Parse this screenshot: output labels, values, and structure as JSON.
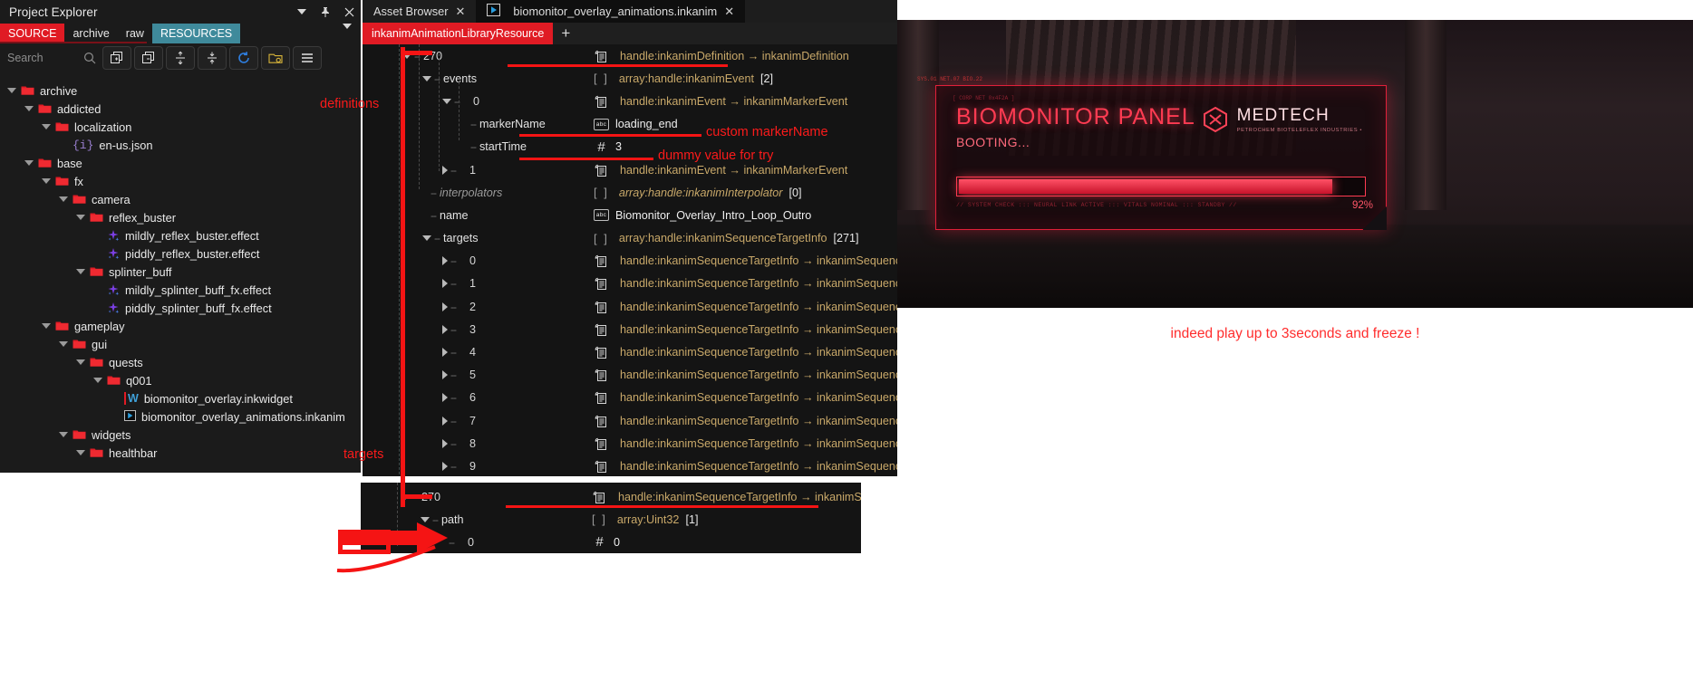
{
  "project_explorer": {
    "title": "Project Explorer",
    "window_buttons": [
      "chevron-down",
      "pin",
      "close"
    ],
    "tabs": [
      {
        "label": "SOURCE",
        "state": "active-source"
      },
      {
        "label": "archive",
        "state": "plain"
      },
      {
        "label": "raw",
        "state": "plain"
      },
      {
        "label": "RESOURCES",
        "state": "active-resources"
      }
    ],
    "search": {
      "placeholder": "Search",
      "value": ""
    },
    "toolbar_buttons": [
      "expand-all-icon",
      "collapse-all-icon",
      "expand-vertical-icon",
      "collapse-vertical-icon",
      "refresh-icon",
      "open-folder-icon",
      "menu-icon"
    ],
    "tree": [
      {
        "depth": 0,
        "label": "archive",
        "kind": "folder",
        "expanded": true
      },
      {
        "depth": 1,
        "label": "addicted",
        "kind": "folder",
        "expanded": true
      },
      {
        "depth": 2,
        "label": "localization",
        "kind": "folder",
        "expanded": true
      },
      {
        "depth": 3,
        "label": "en-us.json",
        "kind": "json"
      },
      {
        "depth": 1,
        "label": "base",
        "kind": "folder",
        "expanded": true
      },
      {
        "depth": 2,
        "label": "fx",
        "kind": "folder",
        "expanded": true
      },
      {
        "depth": 3,
        "label": "camera",
        "kind": "folder",
        "expanded": true
      },
      {
        "depth": 4,
        "label": "reflex_buster",
        "kind": "folder",
        "expanded": true
      },
      {
        "depth": 5,
        "label": "mildly_reflex_buster.effect",
        "kind": "effect"
      },
      {
        "depth": 5,
        "label": "piddly_reflex_buster.effect",
        "kind": "effect"
      },
      {
        "depth": 4,
        "label": "splinter_buff",
        "kind": "folder",
        "expanded": true
      },
      {
        "depth": 5,
        "label": "mildly_splinter_buff_fx.effect",
        "kind": "effect"
      },
      {
        "depth": 5,
        "label": "piddly_splinter_buff_fx.effect",
        "kind": "effect"
      },
      {
        "depth": 2,
        "label": "gameplay",
        "kind": "folder",
        "expanded": true
      },
      {
        "depth": 3,
        "label": "gui",
        "kind": "folder",
        "expanded": true
      },
      {
        "depth": 4,
        "label": "quests",
        "kind": "folder",
        "expanded": true
      },
      {
        "depth": 5,
        "label": "q001",
        "kind": "folder",
        "expanded": true
      },
      {
        "depth": 6,
        "label": "biomonitor_overlay.inkwidget",
        "kind": "widget"
      },
      {
        "depth": 6,
        "label": "biomonitor_overlay_animations.inkanim",
        "kind": "inkanim"
      },
      {
        "depth": 3,
        "label": "widgets",
        "kind": "folder",
        "expanded": true
      },
      {
        "depth": 4,
        "label": "healthbar",
        "kind": "folder",
        "expanded": true
      }
    ]
  },
  "editor": {
    "tabs": [
      {
        "label": "Asset Browser",
        "active": false,
        "closable": true,
        "icon": null
      },
      {
        "label": "biomonitor_overlay_animations.inkanim",
        "active": true,
        "closable": true,
        "icon": "play-icon"
      }
    ],
    "resource_chip": "inkanimAnimationLibraryResource",
    "add_tab": "+",
    "rows": [
      {
        "indent": 1,
        "arrow": "open",
        "index": "270",
        "icon": "handle",
        "type": "handle:inkanimDefinition → inkanimDefinition",
        "underlined": true
      },
      {
        "indent": 2,
        "arrow": "open",
        "key": "events",
        "bracket": "[  ]",
        "type": "array:handle:inkanimEvent",
        "count": "[2]"
      },
      {
        "indent": 3,
        "arrow": "open",
        "index": "0",
        "icon": "handle",
        "type": "handle:inkanimEvent → inkanimMarkerEvent"
      },
      {
        "indent": 4,
        "arrow": "none",
        "key": "markerName",
        "icon": "abc",
        "value": "loading_end"
      },
      {
        "indent": 4,
        "arrow": "none",
        "key": "startTime",
        "icon": "hash",
        "value": "3"
      },
      {
        "indent": 3,
        "arrow": "closed",
        "index": "1",
        "icon": "handle",
        "type": "handle:inkanimEvent → inkanimMarkerEvent"
      },
      {
        "indent": 2,
        "arrow": "none",
        "key": "interpolators",
        "muted": true,
        "bracket": "[  ]",
        "type": "array:handle:inkanimInterpolator",
        "count": "[0]",
        "italic": true
      },
      {
        "indent": 2,
        "arrow": "none",
        "key": "name",
        "icon": "abc",
        "value": "Biomonitor_Overlay_Intro_Loop_Outro"
      },
      {
        "indent": 2,
        "arrow": "open",
        "key": "targets",
        "bracket": "[  ]",
        "type": "array:handle:inkanimSequenceTargetInfo",
        "count": "[271]"
      },
      {
        "indent": 3,
        "arrow": "closed",
        "index": "0",
        "icon": "handle",
        "type": "handle:inkanimSequenceTargetInfo → inkanimSequenceTargetInfo"
      },
      {
        "indent": 3,
        "arrow": "closed",
        "index": "1",
        "icon": "handle",
        "type": "handle:inkanimSequenceTargetInfo → inkanimSequenceTargetInfo"
      },
      {
        "indent": 3,
        "arrow": "closed",
        "index": "2",
        "icon": "handle",
        "type": "handle:inkanimSequenceTargetInfo → inkanimSequenceTargetInfo"
      },
      {
        "indent": 3,
        "arrow": "closed",
        "index": "3",
        "icon": "handle",
        "type": "handle:inkanimSequenceTargetInfo → inkanimSequenceTargetInfo"
      },
      {
        "indent": 3,
        "arrow": "closed",
        "index": "4",
        "icon": "handle",
        "type": "handle:inkanimSequenceTargetInfo → inkanimSequenceTargetInfo"
      },
      {
        "indent": 3,
        "arrow": "closed",
        "index": "5",
        "icon": "handle",
        "type": "handle:inkanimSequenceTargetInfo → inkanimSequenceTargetInfo"
      },
      {
        "indent": 3,
        "arrow": "closed",
        "index": "6",
        "icon": "handle",
        "type": "handle:inkanimSequenceTargetInfo → inkanimSequenceTargetInfo"
      },
      {
        "indent": 3,
        "arrow": "closed",
        "index": "7",
        "icon": "handle",
        "type": "handle:inkanimSequenceTargetInfo → inkanimSequenceTargetInfo"
      },
      {
        "indent": 3,
        "arrow": "closed",
        "index": "8",
        "icon": "handle",
        "type": "handle:inkanimSequenceTargetInfo → inkanimSequenceTargetInfo"
      },
      {
        "indent": 3,
        "arrow": "closed",
        "index": "9",
        "icon": "handle",
        "type": "handle:inkanimSequenceTargetInfo → inkanimSequenceTargetInfo"
      }
    ]
  },
  "bottom_panel": {
    "rows": [
      {
        "indent": 1,
        "arrow": "open",
        "index": "270",
        "icon": "handle",
        "type": "handle:inkanimSequenceTargetInfo → inkanimSequenceTargetInfo",
        "underlined": true
      },
      {
        "indent": 2,
        "arrow": "open",
        "key": "path",
        "bracket": "[  ]",
        "type": "array:Uint32",
        "count": "[1]"
      },
      {
        "indent": 3,
        "arrow": "none",
        "index": "0",
        "icon": "hash",
        "value": "0"
      }
    ]
  },
  "annotations": [
    {
      "id": "definitions",
      "text": "definitions"
    },
    {
      "id": "targets",
      "text": "targets"
    },
    {
      "id": "custom-marker-name",
      "text": "custom markerName"
    },
    {
      "id": "dummy-value",
      "text": "dummy value for try"
    }
  ],
  "game_screenshot": {
    "panel_title": "BIOMONITOR PANEL",
    "panel_status": "BOOTING...",
    "progress_percent": "92%",
    "progress_value": 92,
    "brand_name": "MEDTECH",
    "brand_sub": "PETROCHEM BIOTELEFLEX INDUSTRIES •",
    "micro_text": "// SYSTEM CHECK ::: NEURAL LINK ACTIVE ::: VITALS NOMINAL ::: STANDBY //",
    "micro_text_2": "[ CORP NET 0x4F2A ]",
    "left_glyphs": "SYS.01\nNET.07\nBIO.22",
    "caption": "indeed play up to 3seconds and freeze !"
  },
  "colors": {
    "accent_red": "#e01b24",
    "annotation_red": "#fb1b1b",
    "teal_tab": "#3f8a9b",
    "type_gold": "#c8a869",
    "hud_red": "#ff3b52",
    "panel_bg": "#141414",
    "explorer_bg": "#1b1b1b"
  }
}
